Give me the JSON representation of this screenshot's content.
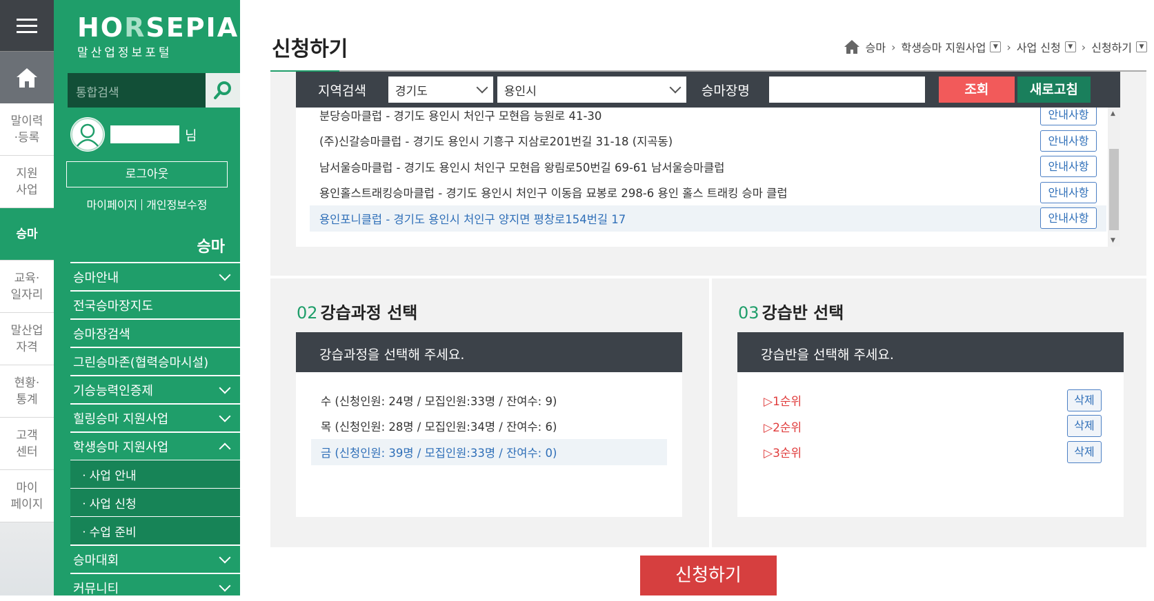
{
  "rail": {
    "items": [
      {
        "label": "말이력\n·등록"
      },
      {
        "label": "지원\n사업"
      },
      {
        "label": "승마"
      },
      {
        "label": "교육·\n일자리"
      },
      {
        "label": "말산업\n자격"
      },
      {
        "label": "현황·\n통계"
      },
      {
        "label": "고객\n센터"
      },
      {
        "label": "마이\n페이지"
      }
    ]
  },
  "sidebar": {
    "logo_main_left": "HO",
    "logo_main_r": "R",
    "logo_main_right": "SEPIA",
    "logo_sub": "말산업정보포털",
    "search_placeholder": "통합검색",
    "user_suffix": "님",
    "logout_label": "로그아웃",
    "mypage_label": "마이페이지",
    "privacy_label": "개인정보수정",
    "section_title": "승마",
    "nav": [
      {
        "label": "승마안내"
      },
      {
        "label": "전국승마장지도"
      },
      {
        "label": "승마장검색"
      },
      {
        "label": "그린승마존(협력승마시설)"
      },
      {
        "label": "기승능력인증제"
      },
      {
        "label": "힐링승마 지원사업"
      },
      {
        "label": "학생승마 지원사업"
      },
      {
        "label": "ㆍ사업 안내"
      },
      {
        "label": "ㆍ사업 신청"
      },
      {
        "label": "ㆍ수업 준비"
      },
      {
        "label": "승마대회"
      },
      {
        "label": "커뮤니티"
      }
    ]
  },
  "header": {
    "title": "신청하기",
    "breadcrumb": [
      "승마",
      "학생승마 지원사업",
      "사업 신청",
      "신청하기"
    ]
  },
  "filter": {
    "region_label": "지역검색",
    "province": "경기도",
    "city": "용인시",
    "club_label": "승마장명",
    "search_button": "조회",
    "reset_button": "새로고침"
  },
  "clubs": [
    {
      "name": "분당승마클럽 - 경기도 용인시 처인구 모현읍 능원로 41-30",
      "btn": "안내사항"
    },
    {
      "name": "(주)신갈승마클럽 - 경기도 용인시 기흥구 지삼로201번길 31-18 (지곡동)",
      "btn": "안내사항"
    },
    {
      "name": "남서울승마클럽 - 경기도 용인시 처인구 모현읍 왕림로50번길 69-61 남서울승마클럽",
      "btn": "안내사항"
    },
    {
      "name": "용인홀스트래킹승마클럽 - 경기도 용인시 처인구 이동읍 묘봉로 298-6 용인 홀스 트래킹 승마 클럽",
      "btn": "안내사항"
    },
    {
      "name": "용인포니클럽 - 경기도 용인시 처인구 양지면 평창로154번길 17",
      "btn": "안내사항"
    }
  ],
  "course_section": {
    "num": "02",
    "title": "강습과정 선택",
    "header": "강습과정을 선택해 주세요.",
    "rows": [
      "수 (신청인원: 24명 / 모집인원:33명 / 잔여수: 9)",
      "목 (신청인원: 28명 / 모집인원:34명 / 잔여수: 6)",
      "금 (신청인원: 39명 / 모집인원:33명 / 잔여수: 0)"
    ]
  },
  "class_section": {
    "num": "03",
    "title": "강습반 선택",
    "header": "강습반을 선택해 주세요.",
    "ranks": [
      "▷1순위",
      "▷2순위",
      "▷3순위"
    ],
    "delete_label": "삭제"
  },
  "apply_button": "신청하기",
  "colors": {
    "brand_green": "#1f9e6a",
    "dark_bar": "#3c4249",
    "search_red": "#f25a5a",
    "apply_red": "#d63f3f"
  }
}
